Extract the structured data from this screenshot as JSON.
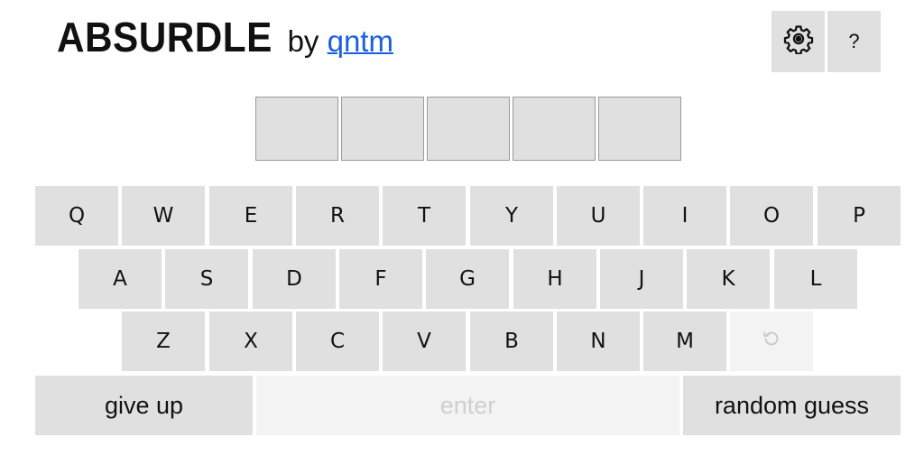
{
  "header": {
    "title": "ABSURDLE",
    "by_text": "by",
    "author": "qntm"
  },
  "toolbar": {
    "settings_icon": "gear-icon",
    "help_label": "?"
  },
  "guess_tiles": [
    "",
    "",
    "",
    "",
    ""
  ],
  "keyboard": {
    "row1": [
      "Q",
      "W",
      "E",
      "R",
      "T",
      "Y",
      "U",
      "I",
      "O",
      "P"
    ],
    "row2": [
      "A",
      "S",
      "D",
      "F",
      "G",
      "H",
      "J",
      "K",
      "L"
    ],
    "row3": [
      "Z",
      "X",
      "C",
      "V",
      "B",
      "N",
      "M"
    ],
    "backspace_icon": "undo-icon",
    "give_up_label": "give up",
    "enter_label": "enter",
    "random_guess_label": "random guess"
  },
  "colors": {
    "key_bg": "#e0e0e0",
    "disabled_bg": "#f3f3f3",
    "link": "#1a5fe0"
  }
}
